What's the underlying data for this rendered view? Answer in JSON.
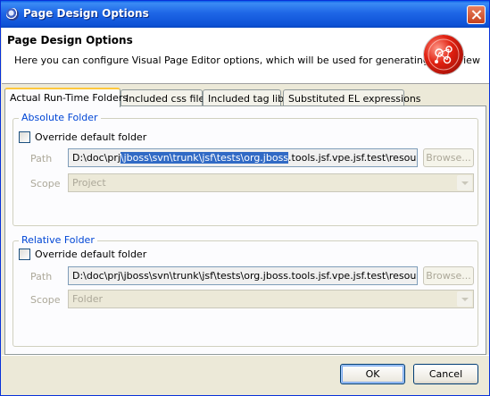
{
  "window": {
    "title": "Page Design Options",
    "header_title": "Page Design Options",
    "header_description": "Here you can configure Visual Page Editor options, which will be used for generating a preview",
    "title_icon": "eclipse-icon",
    "logo_icon": "jboss-tools-logo"
  },
  "tabs": [
    {
      "label": "Actual Run-Time Folders",
      "active": true
    },
    {
      "label": "Included css files",
      "active": false
    },
    {
      "label": "Included tag libs",
      "active": false
    },
    {
      "label": "Substituted EL expressions",
      "active": false
    }
  ],
  "absolute_folder": {
    "legend": "Absolute Folder",
    "override_label": "Override default folder",
    "override_checked": false,
    "path_label": "Path",
    "path_prefix": "D:\\doc\\prj",
    "path_selected": "\\jboss\\svn\\trunk\\jsf\\tests\\org.jboss",
    "path_suffix": ".tools.jsf.vpe.jsf.test\\resources\\j",
    "browse_label": "Browse...",
    "scope_label": "Scope",
    "scope_value": "Project"
  },
  "relative_folder": {
    "legend": "Relative Folder",
    "override_label": "Override default folder",
    "override_checked": false,
    "path_label": "Path",
    "path_value": "D:\\doc\\prj\\jboss\\svn\\trunk\\jsf\\tests\\org.jboss.tools.jsf.vpe.jsf.test\\resources\\j",
    "browse_label": "Browse...",
    "scope_label": "Scope",
    "scope_value": "Folder"
  },
  "buttons": {
    "ok": "OK",
    "cancel": "Cancel"
  },
  "colors": {
    "titlebar": "#0a5fe8",
    "group_legend": "#0046d5",
    "selection": "#316ac5",
    "active_tab_accent": "#ffc83c"
  }
}
